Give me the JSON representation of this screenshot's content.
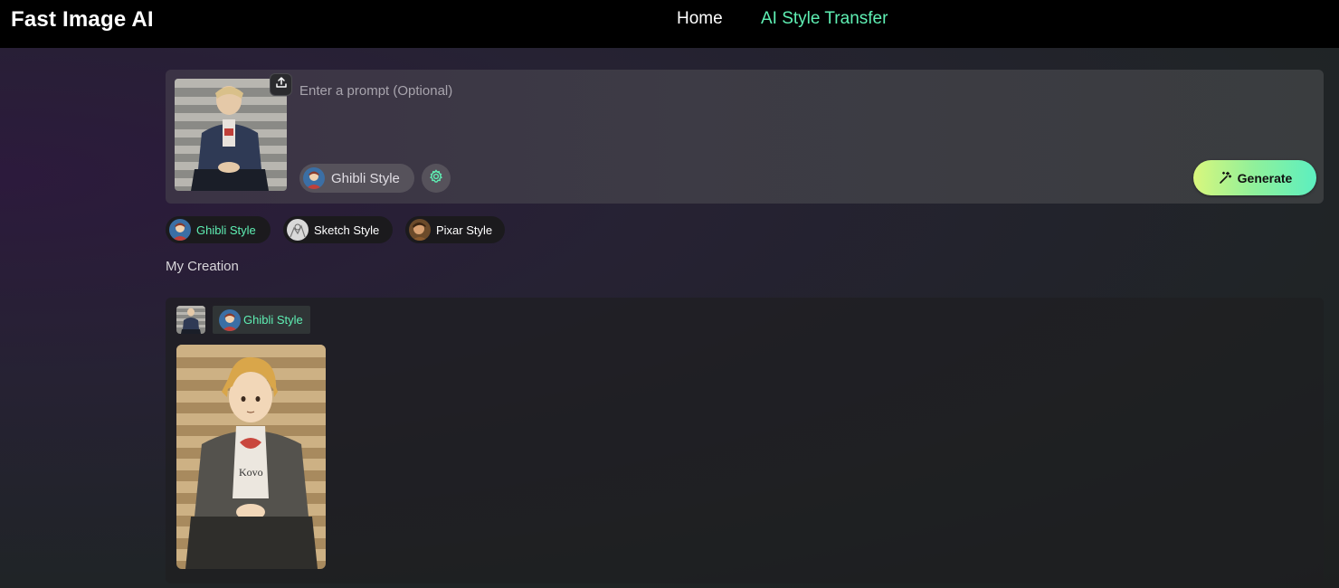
{
  "header": {
    "brand": "Fast Image AI",
    "nav": {
      "home": "Home",
      "style_transfer": "AI Style Transfer"
    }
  },
  "prompt_card": {
    "input_placeholder": "Enter a prompt (Optional)",
    "input_value": "",
    "selected_style": "Ghibli Style",
    "generate_label": "Generate",
    "icons": [
      "upload-icon",
      "gear-icon",
      "magic-wand-icon"
    ]
  },
  "style_chips": [
    {
      "label": "Ghibli Style",
      "selected": true
    },
    {
      "label": "Sketch Style",
      "selected": false
    },
    {
      "label": "Pixar Style",
      "selected": false
    }
  ],
  "creations": {
    "title": "My Creation",
    "items": [
      {
        "style_tag": "Ghibli Style"
      }
    ]
  },
  "colors": {
    "accent": "#5ff0b4",
    "topbar": "#000000",
    "generate_gradient_start": "#d9f77d",
    "generate_gradient_end": "#5cefc0"
  }
}
